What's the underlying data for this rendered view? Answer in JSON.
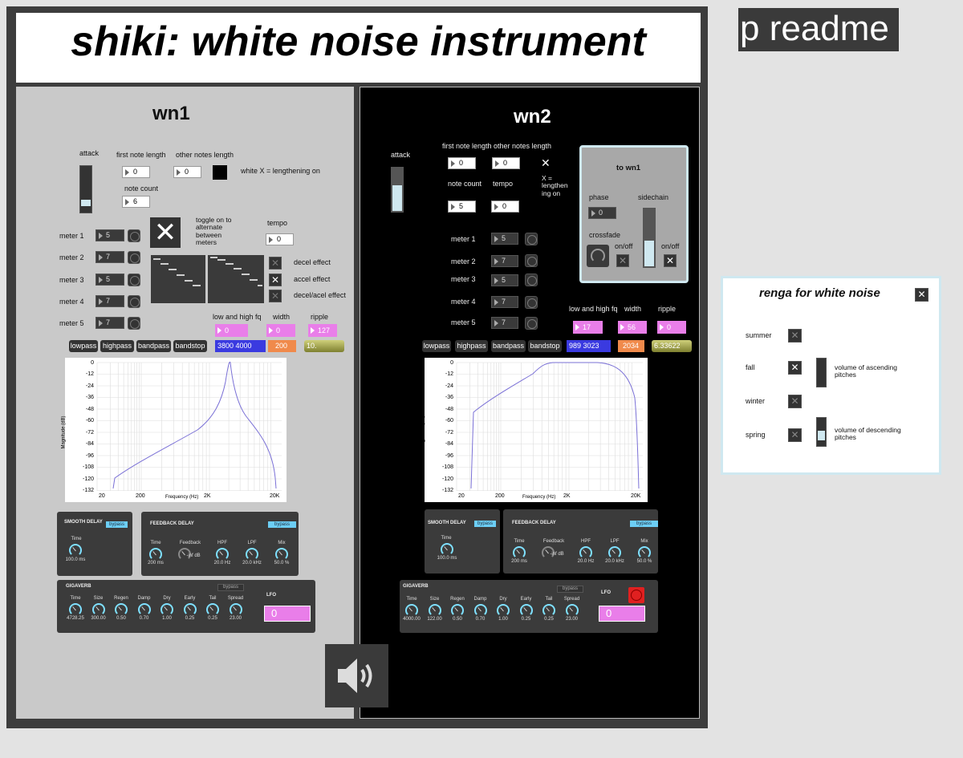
{
  "title": "shiki: white noise instrument",
  "readme_button": "p readme",
  "wn1": {
    "heading": "wn1",
    "attack": "attack",
    "first_note_length": "first note length",
    "first_note_value": "0",
    "other_notes_length": "other notes length",
    "other_notes_value": "0",
    "lengthening_label": "white X = lengthening on",
    "note_count": "note count",
    "note_count_value": "6",
    "toggle_label": "toggle on to alternate between meters",
    "tempo": "tempo",
    "tempo_value": "0",
    "meters": [
      {
        "label": "meter 1",
        "value": "5"
      },
      {
        "label": "meter 2",
        "value": "7"
      },
      {
        "label": "meter 3",
        "value": "5"
      },
      {
        "label": "meter 4",
        "value": "7"
      },
      {
        "label": "meter 5",
        "value": "7"
      }
    ],
    "effects": [
      "decel effect",
      "accel effect",
      "decel/acel effect"
    ],
    "low_high_fq": "low and high fq",
    "low_high_value": "0",
    "width": "width",
    "width_value": "0",
    "ripple": "ripple",
    "ripple_value": "127",
    "filters": [
      "lowpass",
      "highpass",
      "bandpass",
      "bandstop"
    ],
    "fq_readout": "3800 4000",
    "width_readout": "200",
    "ripple_readout": "10.",
    "lfo": "LFO",
    "lfo_value": "0",
    "smooth_delay": {
      "title": "SMOOTH DELAY",
      "bypass": "bypass",
      "time_label": "Time",
      "time_value": "100.0 ms"
    },
    "feedback_delay": {
      "title": "FEEDBACK DELAY",
      "bypass": "bypass",
      "knobs": [
        {
          "label": "Time",
          "value": "200 ms"
        },
        {
          "label": "Feedback",
          "value": "-inf dB"
        },
        {
          "label": "HPF",
          "value": "20.0 Hz"
        },
        {
          "label": "LPF",
          "value": "20.0 kHz"
        },
        {
          "label": "Mix",
          "value": "50.0 %"
        }
      ]
    },
    "gigaverb": {
      "title": "GIGAVERB",
      "bypass": "bypass",
      "knobs": [
        {
          "label": "Time",
          "value": "4728.25"
        },
        {
          "label": "Size",
          "value": "300.00"
        },
        {
          "label": "Regen",
          "value": "0.50"
        },
        {
          "label": "Damp",
          "value": "0.70"
        },
        {
          "label": "Dry",
          "value": "1.00"
        },
        {
          "label": "Early",
          "value": "0.25"
        },
        {
          "label": "Tail",
          "value": "0.25"
        },
        {
          "label": "Spread",
          "value": "23.00"
        }
      ]
    }
  },
  "wn2": {
    "heading": "wn2",
    "attack": "attack",
    "first_note_length": "first note length",
    "first_note_value": "0",
    "other_notes_length": "other notes length",
    "other_notes_value": "0",
    "lengthening_label": "X = lengthen ing on",
    "note_count": "note count",
    "note_count_value": "5",
    "tempo": "tempo",
    "tempo_value": "0",
    "meters": [
      {
        "label": "meter 1",
        "value": "5"
      },
      {
        "label": "meter 2",
        "value": "7"
      },
      {
        "label": "meter 3",
        "value": "5"
      },
      {
        "label": "meter 4",
        "value": "7"
      },
      {
        "label": "meter 5",
        "value": "7"
      }
    ],
    "to_wn1": {
      "title": "to wn1",
      "phase": "phase",
      "phase_value": "0",
      "sidechain": "sidechain",
      "crossfade": "crossfade",
      "onoff1": "on/off",
      "onoff2": "on/off"
    },
    "low_high_fq": "low and high fq",
    "low_high_value": "17",
    "width": "width",
    "width_value": "56",
    "ripple": "ripple",
    "ripple_value": "0",
    "filters": [
      "lowpass",
      "highpass",
      "bandpass",
      "bandstop"
    ],
    "fq_readout": "989 3023",
    "width_readout": "2034",
    "ripple_readout": "6.33622",
    "lfo": "LFO",
    "lfo_value": "0",
    "smooth_delay": {
      "title": "SMOOTH DELAY",
      "bypass": "bypass",
      "time_label": "Time",
      "time_value": "100.0 ms"
    },
    "feedback_delay": {
      "title": "FEEDBACK DELAY",
      "bypass": "bypass",
      "knobs": [
        {
          "label": "Time",
          "value": "200 ms"
        },
        {
          "label": "Feedback",
          "value": "-inf dB"
        },
        {
          "label": "HPF",
          "value": "20.0 Hz"
        },
        {
          "label": "LPF",
          "value": "20.0 kHz"
        },
        {
          "label": "Mix",
          "value": "50.0 %"
        }
      ]
    },
    "gigaverb": {
      "title": "GIGAVERB",
      "bypass": "bypass",
      "knobs": [
        {
          "label": "Time",
          "value": "4000.00"
        },
        {
          "label": "Size",
          "value": "122.00"
        },
        {
          "label": "Regen",
          "value": "0.50"
        },
        {
          "label": "Damp",
          "value": "0.70"
        },
        {
          "label": "Dry",
          "value": "1.00"
        },
        {
          "label": "Early",
          "value": "0.25"
        },
        {
          "label": "Tail",
          "value": "0.25"
        },
        {
          "label": "Spread",
          "value": "23.00"
        }
      ]
    }
  },
  "plot": {
    "y_ticks": [
      "0",
      "-12",
      "-24",
      "-36",
      "-48",
      "-60",
      "-72",
      "-84",
      "-96",
      "-108",
      "-120",
      "-132"
    ],
    "x_ticks": [
      "20",
      "200",
      "2K",
      "20K"
    ],
    "ylabel": "Magnitude (dB)",
    "xlabel": "Frequency (Hz)"
  },
  "renga": {
    "title": "renga for white noise",
    "seasons": [
      "summer",
      "fall",
      "winter",
      "spring"
    ],
    "ascending": "volume of ascending pitches",
    "descending": "volume of descending pitches"
  },
  "colors": {
    "accent_pink": "#e97ee9",
    "accent_blue": "#3a3ae0",
    "accent_orange": "#f08a4b",
    "knob": "#7fe0ff",
    "curve": "#7a70d6"
  }
}
